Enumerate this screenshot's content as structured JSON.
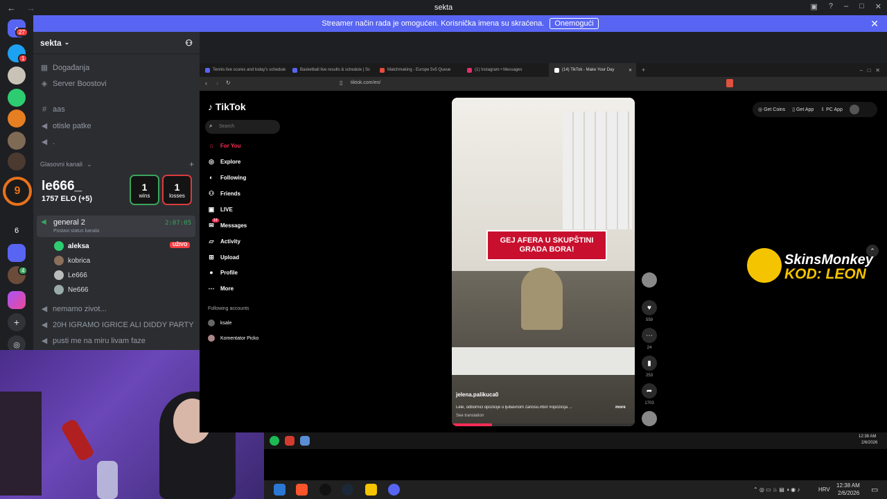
{
  "titlebar": {
    "title": "sekta",
    "back": "←",
    "forward": "→"
  },
  "banner": {
    "text": "Streamer način rada je omogućen. Korisnička imena su skraćena.",
    "button": "Onemogući",
    "close": "✕"
  },
  "rail": {
    "badges": [
      "27",
      "1",
      "4"
    ]
  },
  "server": {
    "name": "sekta",
    "top_items": [
      "Događanja",
      "Server Boostovi"
    ],
    "text_channels": [
      "aas",
      "otisle patke",
      "."
    ],
    "voice_category": "Glasovni kanali",
    "voice_channel": {
      "name": "general 2",
      "timer": "2:07:05",
      "status": "Postavi status kanala"
    },
    "voice_users": [
      {
        "name": "aleksa",
        "live": "UŽIVO"
      },
      {
        "name": "kobrica"
      },
      {
        "name": "Le666"
      },
      {
        "name": "Ne666"
      }
    ],
    "more_channels": [
      "nemamo zivot...",
      "20H IGRAMO IGRICE ALI DIDDY PARTY",
      "pusti me na miru livam faze"
    ]
  },
  "elo": {
    "level": "9",
    "name": "le666_",
    "elo": "1757 ELO (+5)",
    "wins": "1",
    "wins_label": "wins",
    "losses": "1",
    "losses_label": "losses"
  },
  "browser": {
    "tabs": [
      "Tennis live scores and today's schedule",
      "Basketball live results & schedule | Sc",
      "Matchmaking - Europe 5v5 Queue",
      "(1) Instagram • Messages",
      "(14) TikTok - Make Your Day"
    ],
    "url": "tiktok.com/en/",
    "tiktok": {
      "logo": "TikTok",
      "search_placeholder": "Search",
      "nav": [
        "For You",
        "Explore",
        "Following",
        "Friends",
        "LIVE",
        "Messages",
        "Activity",
        "Upload",
        "Profile",
        "More"
      ],
      "messages_badge": "14",
      "following_header": "Following accounts",
      "following": [
        "ksale",
        "Komentator Picko"
      ],
      "top_buttons": [
        "Get Coins",
        "Get App",
        "PC App"
      ],
      "video": {
        "caption": "GEJ AFERA U SKUPŠTINI GRADA BORA!",
        "author": "jelena.palikuca0",
        "description": "Lele, odbornici opozicije u ljubavnom zanosu.#bor #opozicija ...",
        "more": "more",
        "see_translation": "See translation",
        "counts": [
          "559",
          "24",
          "253",
          "1703"
        ]
      }
    }
  },
  "sponsor": {
    "name": "SkinsMonkey",
    "code": "KOD: LEON"
  },
  "inner_taskbar": {
    "time": "12:38 AM",
    "date": "2/6/2026"
  },
  "taskbar": {
    "lang": "HRV",
    "time": "12:38 AM",
    "date": "2/6/2026"
  },
  "colors": {
    "accent": "#5865f2",
    "tiktok_red": "#fe2c55",
    "caption_red": "#c8102e",
    "elo_orange": "#e8721c",
    "win_green": "#3ba55c",
    "loss_red": "#d83c3e"
  }
}
